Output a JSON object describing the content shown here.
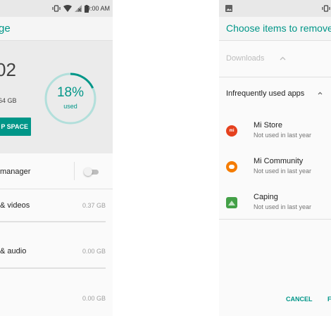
{
  "left_screen": {
    "status_time": "9:00 AM",
    "title_fragment": "ge",
    "storage_number": "02",
    "total_text": "64 GB",
    "free_button_label": "P SPACE",
    "used_percent": 18,
    "used_percent_text": "18%",
    "used_label": "used",
    "rows": [
      {
        "label": "manager",
        "size": "",
        "toggle_on": false
      },
      {
        "label": "& videos",
        "size": "0.37 GB"
      },
      {
        "label": "& audio",
        "size": "0.00 GB"
      },
      {
        "label": "",
        "size": "0.00 GB"
      }
    ]
  },
  "right_screen": {
    "title": "Choose items to remove",
    "section_downloads": "Downloads",
    "section_apps": "Infrequently used apps",
    "apps": [
      {
        "name": "Mi Store",
        "status": "Not used in last year",
        "icon": "mi-store-icon",
        "color": "#e5411e"
      },
      {
        "name": "Mi Community",
        "status": "Not used in last year",
        "icon": "mi-community-icon",
        "color": "#f57c00"
      },
      {
        "name": "Caping",
        "status": "Not used in last year",
        "icon": "caping-icon",
        "color": "#43a047"
      }
    ],
    "cancel_label": "CANCEL",
    "second_action_fragment": "F"
  },
  "colors": {
    "accent": "#009688",
    "card_bg": "#ebebeb",
    "ring_track": "#b2dfdb"
  }
}
